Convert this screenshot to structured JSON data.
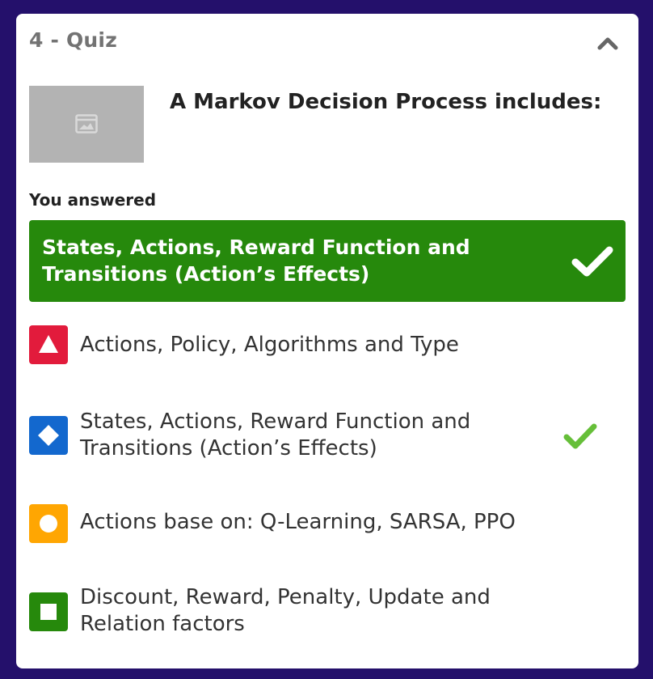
{
  "quiz": {
    "title": "4 - Quiz",
    "question": "A Markov Decision Process includes:",
    "image_alt": "image-placeholder-icon"
  },
  "answer": {
    "heading": "You answered",
    "selected_text": "States, Actions, Reward Function and Transitions (Action’s Effects)",
    "selected_correct": true
  },
  "options": [
    {
      "shape": "triangle",
      "color": "#e21b3c",
      "text": "Actions, Policy, Algorithms and Type",
      "correct": false
    },
    {
      "shape": "diamond",
      "color": "#1368ce",
      "text": "States, Actions, Reward Function and Transitions (Action’s Effects)",
      "correct": true
    },
    {
      "shape": "circle",
      "color": "#ffa602",
      "text": "Actions base on: Q-Learning, SARSA, PPO",
      "correct": false
    },
    {
      "shape": "square",
      "color": "#26890c",
      "text": "Discount, Reward, Penalty, Update and Relation factors",
      "correct": false
    }
  ],
  "colors": {
    "background": "#24106b",
    "correct_green": "#26890c",
    "check_green": "#66bf39"
  }
}
